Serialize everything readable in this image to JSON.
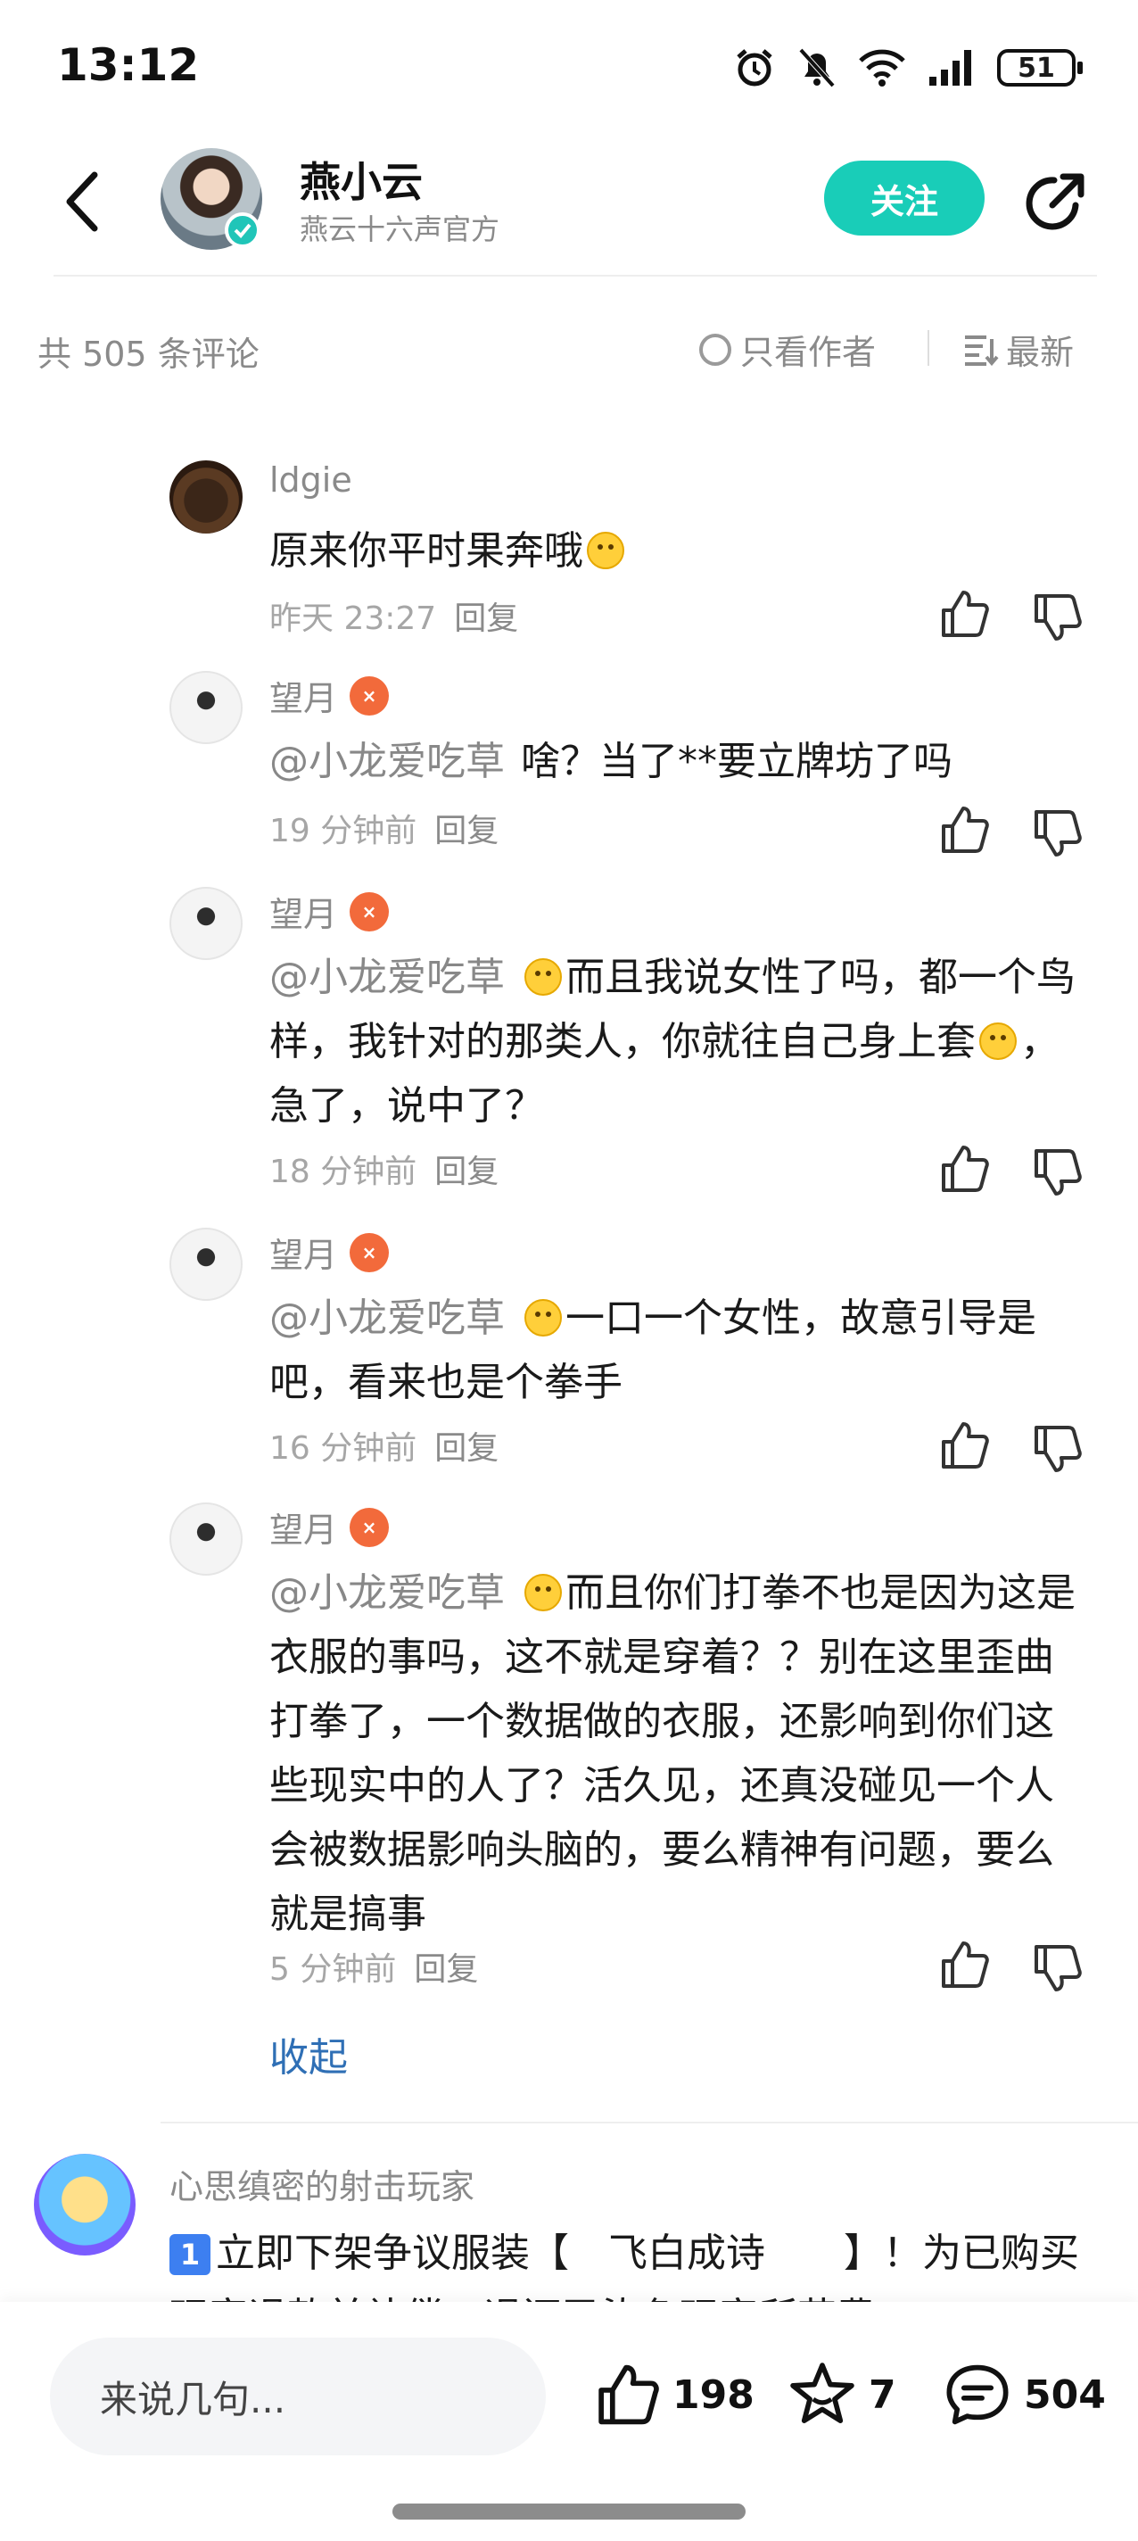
{
  "status_bar": {
    "time": "13:12",
    "battery": "51"
  },
  "header": {
    "name": "燕小云",
    "subtitle": "燕云十六声官方",
    "follow_label": "关注"
  },
  "toolbar": {
    "count_text": "共 505 条评论",
    "author_only_label": "只看作者",
    "sort_label": "最新"
  },
  "replies": [
    {
      "user": "ldgie",
      "has_level_badge": false,
      "mention": "",
      "text": "原来你平时果奔哦",
      "time": "昨天 23:27",
      "reply_label": "回复"
    },
    {
      "user": "望月",
      "has_level_badge": true,
      "mention": "@小龙爱吃草",
      "text": "啥？当了**要立牌坊了吗",
      "time": "19 分钟前",
      "reply_label": "回复"
    },
    {
      "user": "望月",
      "has_level_badge": true,
      "mention": "@小龙爱吃草",
      "text_a": "而且我说女性了吗，都一个鸟样，我针对的那类人，你就往自己身上套",
      "text_b": "，急了，说中了？",
      "time": "18 分钟前",
      "reply_label": "回复"
    },
    {
      "user": "望月",
      "has_level_badge": true,
      "mention": "@小龙爱吃草",
      "text": "一口一个女性，故意引导是吧，看来也是个拳手",
      "time": "16 分钟前",
      "reply_label": "回复"
    },
    {
      "user": "望月",
      "has_level_badge": true,
      "mention": "@小龙爱吃草",
      "text": "而且你们打拳不也是因为这是衣服的事吗，这不就是穿着？？别在这里歪曲打拳了，一个数据做的衣服，还影响到你们这些现实中的人了？活久见，还真没碰见一个人会被数据影响头脑的，要么精神有问题，要么就是搞事",
      "time": "5 分钟前",
      "reply_label": "回复"
    }
  ],
  "collapse_label": "收起",
  "top_comment": {
    "user": "心思缜密的射击玩家",
    "badge_number": "1",
    "text": "立即下架争议服装【　飞白成诗　　】！为已购买玩家退款并补偿，退还已染色玩家所花费"
  },
  "bottom_bar": {
    "input_placeholder": "来说几句...",
    "like_count": "198",
    "favorite_count": "7",
    "comment_count": "504"
  },
  "colors": {
    "accent": "#19cdb8",
    "link": "#2f6fb5",
    "level_badge": "#f26a3b",
    "muted_text": "#8a8a8a"
  },
  "icons": [
    "back-icon",
    "share-icon",
    "alarm-icon",
    "mute-icon",
    "wifi-icon",
    "signal-icon",
    "battery-icon",
    "like-icon",
    "dislike-icon",
    "favorite-icon",
    "comment-icon",
    "sort-icon"
  ]
}
